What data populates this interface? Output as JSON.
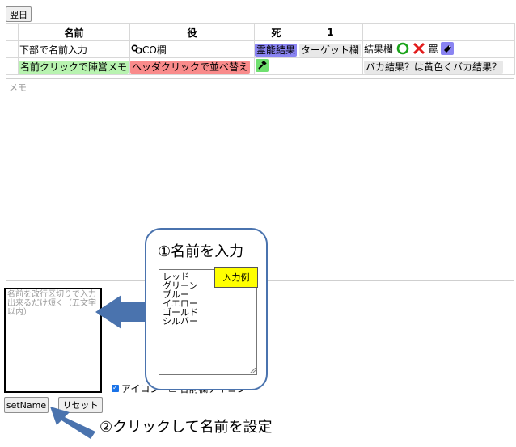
{
  "toolbar": {
    "next_day_label": "翌日"
  },
  "table": {
    "headers": [
      "名前",
      "役",
      "死",
      "1"
    ],
    "row1": {
      "name_hint": "下部で名前入力",
      "role_label": "CO欄",
      "medium_label": "霊能結果",
      "target_label": "ターゲット欄",
      "result_label": "結果欄",
      "result_mark": "罠"
    },
    "row2": {
      "name_click": "名前クリックで陣営メモ",
      "header_click": "ヘッダクリックで並べ替え",
      "baka_label": "バカ結果？は黄色くバカ結果？"
    }
  },
  "memo": {
    "placeholder": "メモ"
  },
  "name_input": {
    "placeholder": "名前を改行区切りで入力 出来るだけ短く（五文字以内）"
  },
  "buttons": {
    "setname": "setName",
    "reset": "リセット"
  },
  "checks": {
    "icon_label": "アイコン",
    "icon_checked": true,
    "name_icon_label": "名前欄アイコン",
    "name_icon_checked": false
  },
  "annotations": {
    "step1": "①名前を入力",
    "example_tag": "入力例",
    "example_text": "レッド\nグリーン\nブルー\nイエロー\nゴールド\nシルバー",
    "step2": "②クリックして名前を設定"
  },
  "colors": {
    "arrow": "#4a73ae",
    "callout_border": "#4a73ae",
    "tag_bg": "#ffff00"
  }
}
